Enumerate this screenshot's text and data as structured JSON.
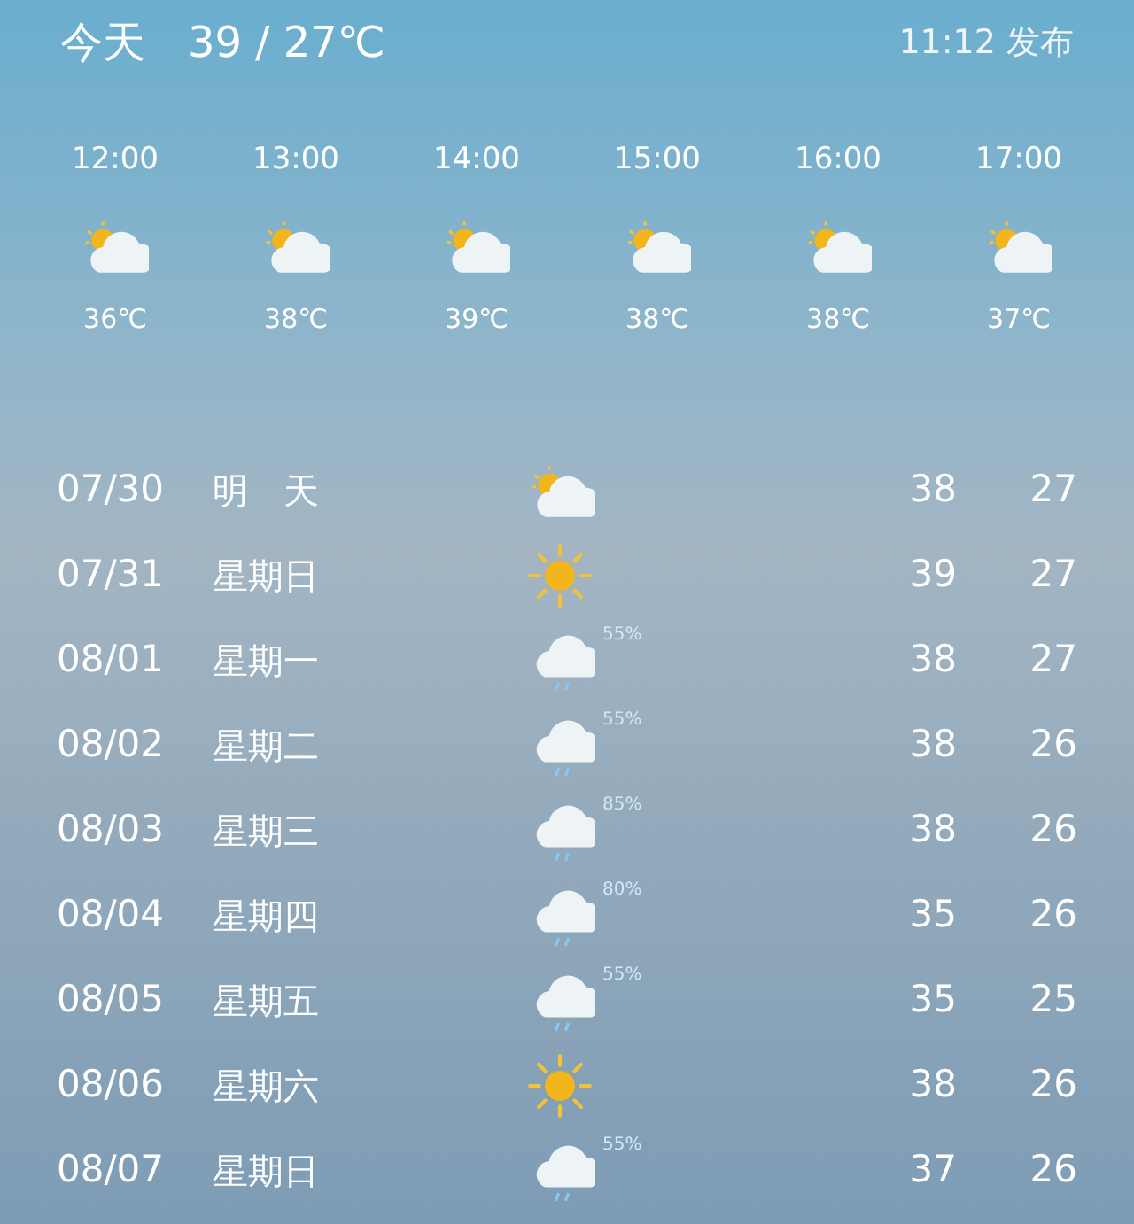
{
  "today": {
    "label": "今天",
    "temps": "39 / 27℃",
    "published": "11:12 发布"
  },
  "hourly": [
    {
      "time": "12:00",
      "kind": "partly-cloudy",
      "temp": "36℃"
    },
    {
      "time": "13:00",
      "kind": "partly-cloudy",
      "temp": "38℃"
    },
    {
      "time": "14:00",
      "kind": "partly-cloudy",
      "temp": "39℃"
    },
    {
      "time": "15:00",
      "kind": "partly-cloudy",
      "temp": "38℃"
    },
    {
      "time": "16:00",
      "kind": "partly-cloudy",
      "temp": "38℃"
    },
    {
      "time": "17:00",
      "kind": "partly-cloudy",
      "temp": "37℃"
    }
  ],
  "daily": [
    {
      "date": "07/30",
      "day": "明　天",
      "kind": "partly-cloudy",
      "high": "38",
      "low": "27"
    },
    {
      "date": "07/31",
      "day": "星期日",
      "kind": "sunny",
      "high": "39",
      "low": "27"
    },
    {
      "date": "08/01",
      "day": "星期一",
      "kind": "rain",
      "chance": "55%",
      "high": "38",
      "low": "27"
    },
    {
      "date": "08/02",
      "day": "星期二",
      "kind": "rain",
      "chance": "55%",
      "high": "38",
      "low": "26"
    },
    {
      "date": "08/03",
      "day": "星期三",
      "kind": "rain",
      "chance": "85%",
      "high": "38",
      "low": "26"
    },
    {
      "date": "08/04",
      "day": "星期四",
      "kind": "rain",
      "chance": "80%",
      "high": "35",
      "low": "26"
    },
    {
      "date": "08/05",
      "day": "星期五",
      "kind": "rain",
      "chance": "55%",
      "high": "35",
      "low": "25"
    },
    {
      "date": "08/06",
      "day": "星期六",
      "kind": "sunny",
      "high": "38",
      "low": "26"
    },
    {
      "date": "08/07",
      "day": "星期日",
      "kind": "rain",
      "chance": "55%",
      "high": "37",
      "low": "26"
    }
  ]
}
